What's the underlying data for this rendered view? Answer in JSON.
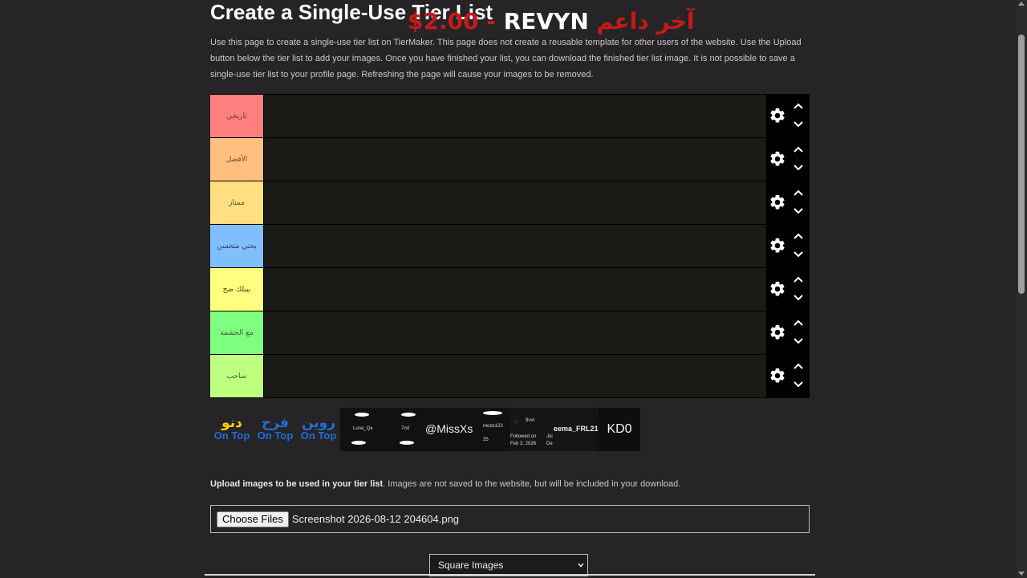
{
  "page": {
    "title": "Create a Single-Use Tier List",
    "overlay": {
      "price": "$2.00 - ",
      "name": "REVYN",
      "arabic": " آخر داعم"
    },
    "description": "Use this page to create a single-use tier list on TierMaker. This page does not create a reusable template for other users of the website. Use the Upload button below the tier list to add your images. Once you have finished your list, you can download the finished tier list image. It is not possible to save a single-use tier list to your profile page. Refreshing the page will cause your images to be removed."
  },
  "tiers": [
    {
      "label": "تاريخي",
      "color": "#ff7f7f",
      "text_color": "#6b3a3a"
    },
    {
      "label": "الأفضل",
      "color": "#ffbf7f",
      "text_color": "#6a4a2a"
    },
    {
      "label": "ممتاز",
      "color": "#ffdf7f",
      "text_color": "#5a5030"
    },
    {
      "label": "يحتي متحسن",
      "color": "#7fbfff",
      "text_color": "#2a3f6a"
    },
    {
      "label": "بيبلك ضح",
      "color": "#ffff7f",
      "text_color": "#4a4a1a"
    },
    {
      "label": "مع الحشمة",
      "color": "#7fff7f",
      "text_color": "#3a5a3a"
    },
    {
      "label": "ساحب",
      "color": "#bfff7f",
      "text_color": "#3f5a2a"
    }
  ],
  "pool": {
    "logos": [
      {
        "arabic": "دنو",
        "arabic_color": "#ffd400",
        "sub": "On Top"
      },
      {
        "arabic": "فرح",
        "arabic_color": "#1f6ed8",
        "sub": "On Top"
      },
      {
        "arabic": "روين",
        "arabic_color": "#1f6ed8",
        "sub": "On Top"
      }
    ],
    "shots": [
      {
        "lines": [
          "Luna_Qe",
          "7nd",
          "moze123",
          "35"
        ]
      },
      {
        "text": "@MissXs"
      },
      {
        "lines": [
          "9vvt",
          "Followed on",
          "Feb 3, 2026",
          "Joi",
          "De"
        ]
      },
      {
        "text": "eema_FRL21"
      },
      {
        "text": "KD0"
      }
    ]
  },
  "upload": {
    "bold": "Upload images to be used in your tier list",
    "rest": ". Images are not saved to the website, but will be included in your download.",
    "button_label": "Choose Files",
    "file_name": "Screenshot 2026-08-12 204604.png"
  },
  "size_select": {
    "selected": "Square Images"
  },
  "icons": {
    "gear": "gear-icon",
    "up": "chevron-up-icon",
    "down": "chevron-down-icon"
  }
}
